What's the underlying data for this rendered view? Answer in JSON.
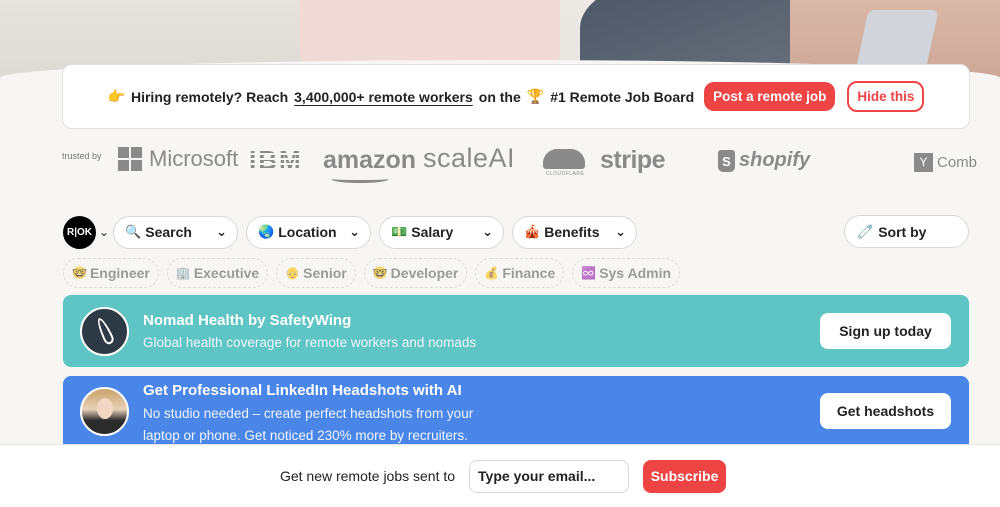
{
  "hiring_banner": {
    "icon": "👉",
    "text_before": "Hiring remotely? Reach",
    "link_text": "3,400,000+ remote workers",
    "text_middle": "on the",
    "trophy": "🏆",
    "text_after": "#1 Remote Job Board",
    "post_button": "Post a remote job",
    "hide_button": "Hide this"
  },
  "trusted": {
    "label": "trusted by",
    "logos": {
      "microsoft": "Microsoft",
      "ibm": "IBM",
      "amazon": "amazon",
      "scaleai": "scaleAI",
      "cloudflare": "CLOUDFLARE",
      "stripe": "stripe",
      "shopify": "shopify",
      "shopify_mark": "S",
      "yc_mark": "Y",
      "yc": "Comb"
    }
  },
  "filters": {
    "logo": "R|OK",
    "search": {
      "icon": "🔍",
      "label": "Search"
    },
    "location": {
      "icon": "🌏",
      "label": "Location"
    },
    "salary": {
      "icon": "💵",
      "label": "Salary"
    },
    "benefits": {
      "icon": "🎪",
      "label": "Benefits"
    },
    "sort": {
      "icon": "🧷",
      "label": "Sort by"
    },
    "chevron": "⌄"
  },
  "tags": [
    {
      "icon": "🤓",
      "label": "Engineer"
    },
    {
      "icon": "🏢",
      "label": "Executive"
    },
    {
      "icon": "👴",
      "label": "Senior"
    },
    {
      "icon": "🤓",
      "label": "Developer"
    },
    {
      "icon": "💰",
      "label": "Finance"
    },
    {
      "icon": "♾️",
      "label": "Sys Admin"
    }
  ],
  "promos": {
    "nomad": {
      "title": "Nomad Health by SafetyWing",
      "subtitle": "Global health coverage for remote workers and nomads",
      "button": "Sign up today",
      "color": "#5fc4c4"
    },
    "linkedin": {
      "title": "Get Professional LinkedIn Headshots with AI",
      "subtitle": "No studio needed – create perfect headshots from your laptop or phone. Get noticed 230% more by recruiters.",
      "button": "Get headshots",
      "color": "#4a86e8"
    }
  },
  "subscribe": {
    "label": "Get new remote jobs sent to",
    "placeholder": "Type your email...",
    "button": "Subscribe"
  },
  "colors": {
    "accent_red": "#ef4444",
    "background": "#f7f6f4"
  }
}
